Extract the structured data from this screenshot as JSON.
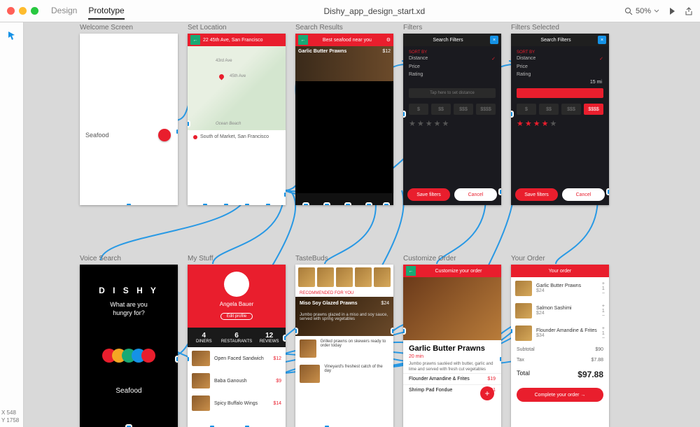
{
  "topbar": {
    "tabs": {
      "design": "Design",
      "prototype": "Prototype"
    },
    "filename": "Dishy_app_design_start.xd",
    "zoom": "50%"
  },
  "artboards": {
    "welcome": {
      "label": "Welcome Screen",
      "text": "Seafood"
    },
    "location": {
      "label": "Set Location",
      "address": "22 45th Ave, San Francisco",
      "streets": {
        "a": "43rd Ave",
        "b": "45th Ave"
      },
      "ocean": "Ocean Beach",
      "caption": "South of Market, San Francisco"
    },
    "results": {
      "label": "Search Results",
      "header": "Best seafood near you",
      "item": {
        "name": "Garlic Butter Prawns",
        "price": "$12"
      }
    },
    "filters": {
      "label": "Filters",
      "title": "Search Filters",
      "sort": "SORT BY",
      "distance": "Distance",
      "price": "Price",
      "rating": "Rating",
      "dist_ph": "Tap here to set distance",
      "d1": "$",
      "d2": "$$",
      "d3": "$$$",
      "d4": "$$$$",
      "save": "Save filters",
      "cancel": "Cancel"
    },
    "filtersSel": {
      "label": "Filters Selected",
      "title": "Search Filters",
      "sort": "SORT BY",
      "distance": "Distance",
      "price": "Price",
      "rating": "Rating",
      "dist_val": "15 mi",
      "d1": "$",
      "d2": "$$",
      "d3": "$$$",
      "d4": "$$$$",
      "save": "Save filters",
      "cancel": "Cancel"
    },
    "voice": {
      "label": "Voice Search",
      "logo": "D I S H Y",
      "q1": "What are you",
      "q2": "hungry for?",
      "word": "Seafood"
    },
    "mystuff": {
      "label": "My Stuff",
      "name": "Angela Bauer",
      "edit": "Edit profile",
      "s1n": "4",
      "s1l": "DINERS",
      "s2n": "6",
      "s2l": "RESTAURANTS",
      "s3n": "12",
      "s3l": "REVIEWS",
      "i1": "Open Faced Sandwich",
      "p1": "$12",
      "i2": "Baba Ganoush",
      "p2": "$9",
      "i3": "Spicy Buffalo Wings",
      "p3": "$14"
    },
    "tastebuds": {
      "label": "TasteBuds",
      "rec": "RECOMMENDED FOR YOU",
      "hero": "Miso Soy Glazed Prawns",
      "hprice": "$24",
      "hdesc": "Jumbo prawns glazed in a miso and soy sauce, served with spring vegetables",
      "i1": "Grilled prawns on skewers ready to order today",
      "i2": "Vineyard's freshest catch of the day"
    },
    "customize": {
      "label": "Customize Order",
      "bar": "Customize your order",
      "title": "Garlic Butter Prawns",
      "eta": "20 min",
      "desc": "Jumbo prawns sautéed with butter, garlic and lime and served with fresh cut vegetables",
      "opt1": "Flounder Amandine & Frites",
      "opt1p": "$19",
      "opt2": "Shrimp Pad Fondue",
      "opt2p": "$21"
    },
    "order": {
      "label": "Your Order",
      "bar": "Your order",
      "i1": "Garlic Butter Prawns",
      "p1": "$24",
      "i2": "Salmon Sashimi",
      "p2": "$24",
      "i3": "Flounder Amandine & Frites",
      "p3": "$34",
      "sub_l": "Subtotal",
      "sub_v": "$90",
      "tax_l": "Tax",
      "tax_v": "$7.88",
      "tot_l": "Total",
      "tot_v": "$97.88",
      "btn": "Complete your order   →"
    }
  },
  "coords": {
    "x": "X  548",
    "y": "Y  1758"
  }
}
